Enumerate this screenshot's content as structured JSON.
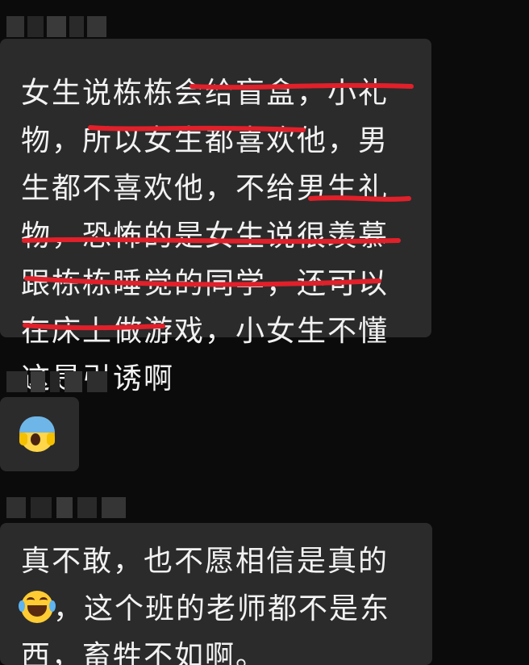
{
  "conversation": {
    "messages": [
      {
        "sender": "pixelated",
        "type": "text",
        "text": "女生说栋栋会给盲盒，小礼物，所以女生都喜欢他，男生都不喜欢他，不给男生礼物，恐怖的是女生说很羡慕跟栋栋睡觉的同学，还可以在床上做游戏，小女生不懂这是引诱啊"
      },
      {
        "sender": "pixelated",
        "type": "emoji",
        "emoji": "face-screaming-in-fear"
      },
      {
        "sender": "pixelated",
        "type": "text",
        "text_part1": "真不敢，也不愿相信是真的",
        "inline_emoji": "face-with-tears-of-joy",
        "text_part2": "，这个班的老师都不是东西，畜牲不如啊。"
      }
    ]
  },
  "colors": {
    "background": "#0b0b0b",
    "bubble": "#2b2b2b",
    "text": "#f2f2f2",
    "underline": "#e0202a"
  }
}
